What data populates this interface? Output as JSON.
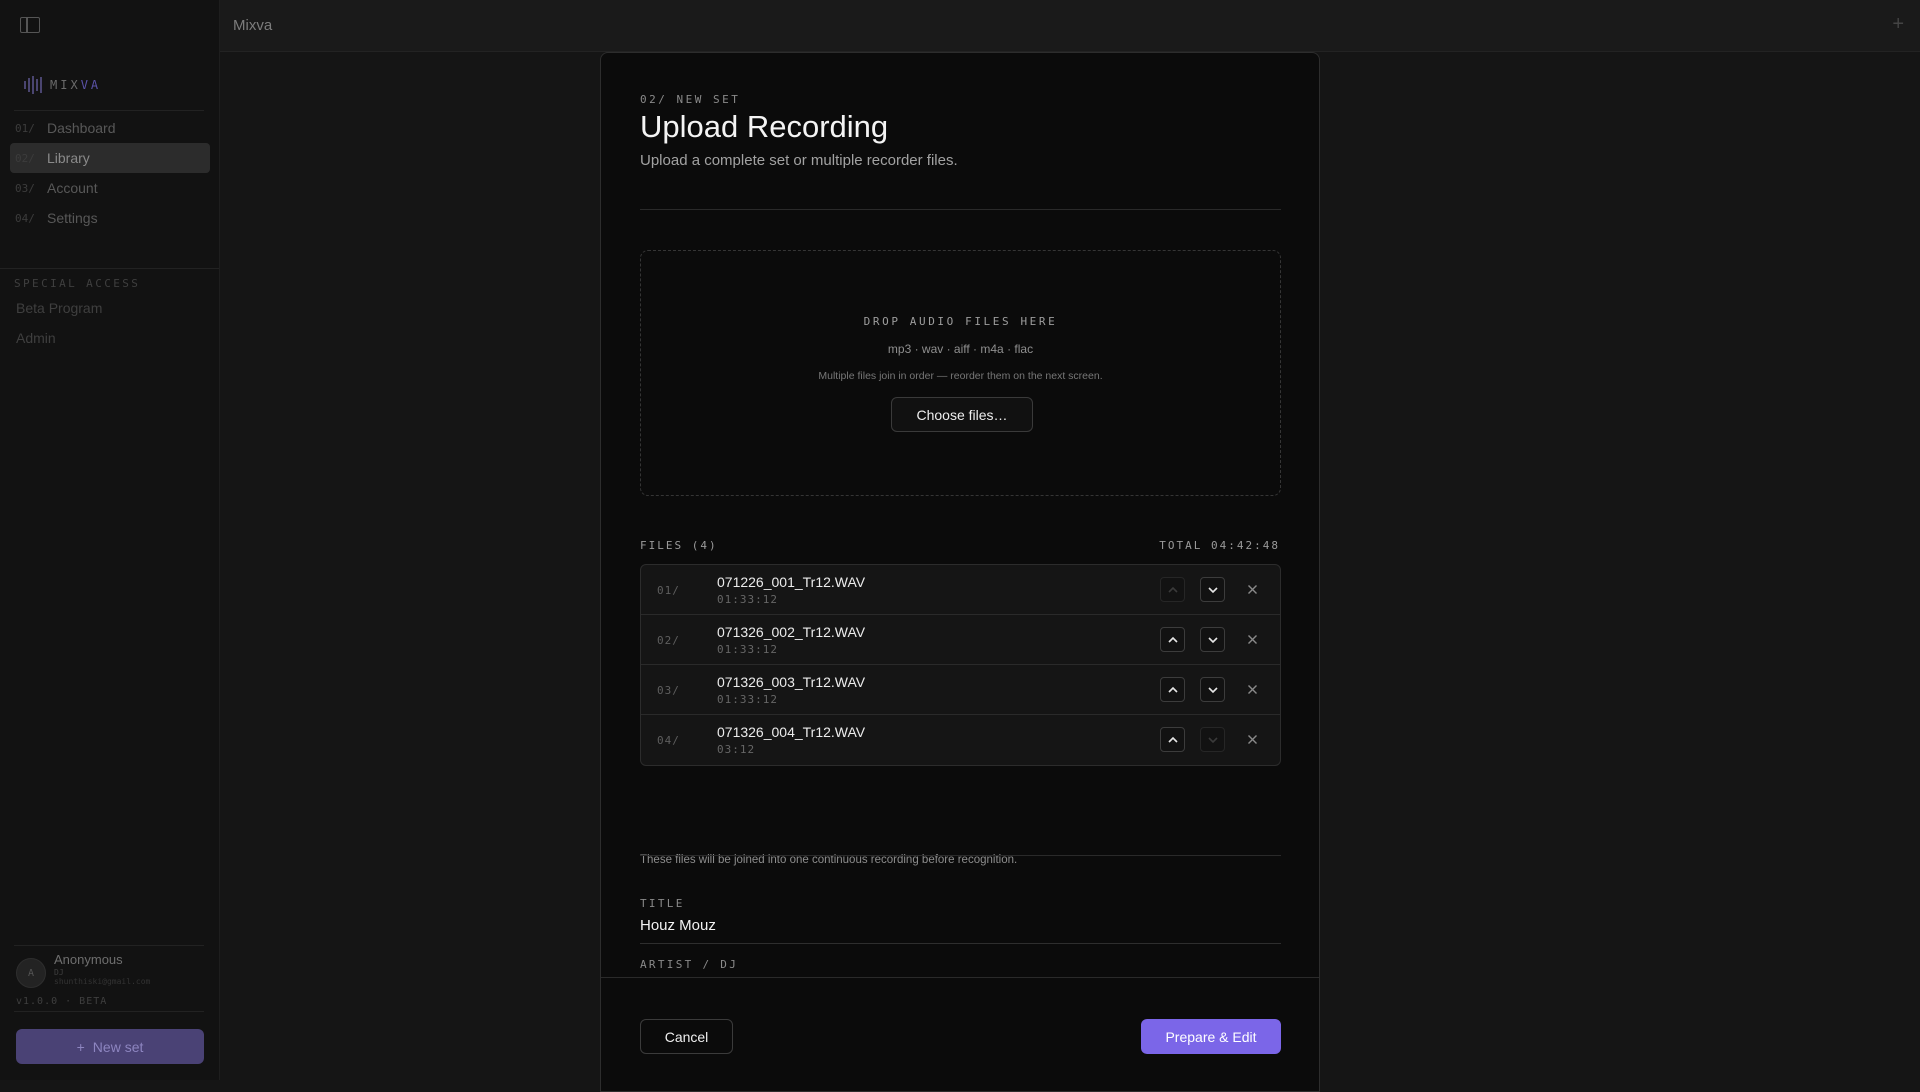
{
  "app": {
    "title": "Mixva"
  },
  "logo": {
    "prefix": "MIX",
    "suffix": "VA"
  },
  "nav": [
    {
      "num": "01/",
      "label": "Dashboard"
    },
    {
      "num": "02/",
      "label": "Library"
    },
    {
      "num": "03/",
      "label": "Account"
    },
    {
      "num": "04/",
      "label": "Settings"
    }
  ],
  "special_access": {
    "label": "SPECIAL ACCESS",
    "items": [
      "Beta Program",
      "Admin"
    ]
  },
  "user": {
    "initial": "A",
    "name": "Anonymous",
    "role": "DJ",
    "email": "shunthiski@gmail.com"
  },
  "version": "v1.0.0 · BETA",
  "new_set_button": {
    "icon": "+",
    "label": "New set"
  },
  "modal": {
    "eyebrow": "02/ NEW SET",
    "title": "Upload Recording",
    "subtitle": "Upload a complete set or multiple recorder files.",
    "dropzone": {
      "title": "DROP AUDIO FILES HERE",
      "formats": "mp3 · wav · aiff · m4a · flac",
      "note": "Multiple files join in order — reorder them on the next screen.",
      "button": "Choose files…"
    },
    "files_label": "FILES (4)",
    "total_label": "TOTAL 04:42:48",
    "files": [
      {
        "num": "01/",
        "name": "071226_001_Tr12.WAV",
        "duration": "01:33:12",
        "up_enabled": false,
        "down_enabled": true
      },
      {
        "num": "02/",
        "name": "071326_002_Tr12.WAV",
        "duration": "01:33:12",
        "up_enabled": true,
        "down_enabled": true
      },
      {
        "num": "03/",
        "name": "071326_003_Tr12.WAV",
        "duration": "01:33:12",
        "up_enabled": true,
        "down_enabled": true
      },
      {
        "num": "04/",
        "name": "071326_004_Tr12.WAV",
        "duration": "03:12",
        "up_enabled": true,
        "down_enabled": false
      }
    ],
    "join_note": "These files will be joined into one continuous recording before recognition.",
    "title_field": {
      "label": "TITLE",
      "value": "Houz Mouz"
    },
    "artist_field": {
      "label": "ARTIST / DJ"
    },
    "cancel_button": "Cancel",
    "submit_button": "Prepare & Edit"
  },
  "colors": {
    "accent": "#7b66e8",
    "background": "#151515",
    "modal": "#0b0b0b"
  }
}
